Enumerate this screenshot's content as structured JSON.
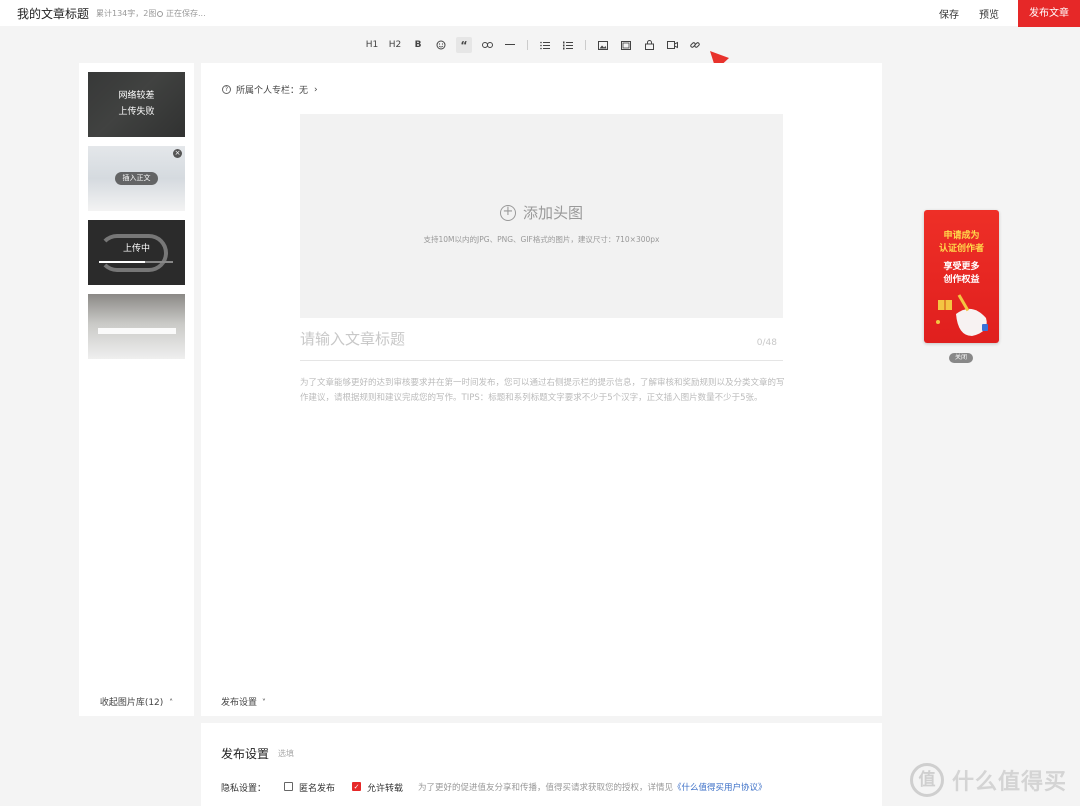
{
  "header": {
    "title": "我的文章标题",
    "word_count": "累计134字，2图",
    "save_status": "正在保存...",
    "save_label": "保存",
    "preview_label": "预览",
    "publish_label": "发布文章"
  },
  "toolbar": {
    "h1": "H1",
    "h2": "H2",
    "bold": "B",
    "quote": "“"
  },
  "gallery": {
    "thumb1_line1": "网络较差",
    "thumb1_line2": "上传失败",
    "thumb2_button": "插入正文",
    "thumb3_status": "上传中",
    "thumb3_progress": 0.62,
    "collapse_label": "收起图片库(12)"
  },
  "editor": {
    "column_label": "所属个人专栏：无",
    "cover_label": "添加头图",
    "cover_hint": "支持10M以内的JPG、PNG、GIF格式的图片，建议尺寸：710×300px",
    "title_placeholder": "请输入文章标题",
    "title_count": "0/48",
    "body_hint": "为了文章能够更好的达到审核要求并在第一时间发布，您可以通过右侧提示栏的提示信息，了解审核和奖励规则以及分类文章的写作建议，请根据规则和建议完成您的写作。TIPS：标题和系列标题文字要求不少于5个汉字，正文插入图片数量不少于5张。",
    "footer_label": "发布设置"
  },
  "settings": {
    "title": "发布设置",
    "optional": "选填",
    "privacy_label": "隐私设置：",
    "anonymous_label": "匿名发布",
    "anonymous_checked": false,
    "allow_repost_label": "允许转载",
    "allow_repost_checked": true,
    "note": "为了更好的促进值友分享和传播，值得买请求获取您的授权，详情见",
    "agreement_link": "《什么值得买用户协议》"
  },
  "ad": {
    "line1": "申请成为",
    "line2": "认证创作者",
    "line3": "享受更多",
    "line4": "创作权益",
    "close_label": "关闭"
  },
  "watermark": {
    "logo": "值",
    "text": "什么值得买"
  },
  "colors": {
    "accent": "#e62828",
    "link": "#3b6fc7"
  }
}
